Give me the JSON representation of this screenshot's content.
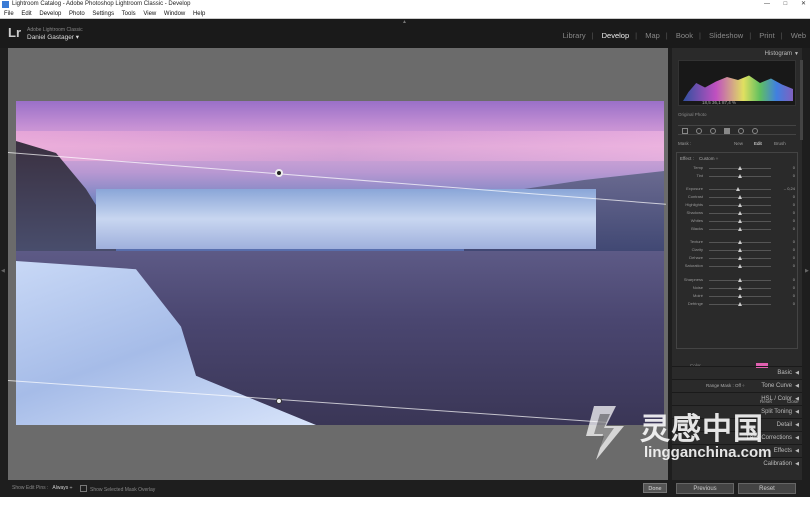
{
  "window": {
    "title": "Lightroom Catalog - Adobe Photoshop Lightroom Classic - Develop",
    "controls": [
      "—",
      "□",
      "✕"
    ]
  },
  "menu": [
    "File",
    "Edit",
    "Develop",
    "Photo",
    "Settings",
    "Tools",
    "View",
    "Window",
    "Help"
  ],
  "identity": {
    "logo": "Lr",
    "brand": "Adobe Lightroom Classic",
    "user": "Daniel Gastager",
    "user_arrow": "▾"
  },
  "modules": [
    "Library",
    "Develop",
    "Map",
    "Book",
    "Slideshow",
    "Print",
    "Web"
  ],
  "active_module": "Develop",
  "panel": {
    "histogram_title": "Histogram",
    "histogram_readout": "18,5  36,1  87,4 %",
    "original_photo": "Original Photo",
    "mask_label": "Mask :",
    "mask_new": "New",
    "mask_edit": "Edit",
    "mask_brush": "Brush",
    "effect_label": "Effect :",
    "effect_value": "Custom ÷",
    "sliders": [
      {
        "label": "Temp",
        "value": "0",
        "pos": 0.5
      },
      {
        "label": "Tint",
        "value": "0",
        "pos": 0.5
      },
      {
        "label": "Exposure",
        "value": "– 0,24",
        "pos": 0.47
      },
      {
        "label": "Contrast",
        "value": "0",
        "pos": 0.5
      },
      {
        "label": "Highlights",
        "value": "0",
        "pos": 0.5
      },
      {
        "label": "Shadows",
        "value": "0",
        "pos": 0.5
      },
      {
        "label": "Whites",
        "value": "0",
        "pos": 0.5
      },
      {
        "label": "Blacks",
        "value": "0",
        "pos": 0.5
      },
      {
        "label": "Texture",
        "value": "0",
        "pos": 0.5
      },
      {
        "label": "Clarity",
        "value": "0",
        "pos": 0.5
      },
      {
        "label": "Dehaze",
        "value": "0",
        "pos": 0.5
      },
      {
        "label": "Saturation",
        "value": "0",
        "pos": 0.5
      },
      {
        "label": "Sharpness",
        "value": "0",
        "pos": 0.5
      },
      {
        "label": "Noise",
        "value": "0",
        "pos": 0.5
      },
      {
        "label": "Moiré",
        "value": "0",
        "pos": 0.5
      },
      {
        "label": "Defringe",
        "value": "0",
        "pos": 0.5
      }
    ],
    "color_label": "Color",
    "color_swatch": "#e060b0",
    "range_mask": "Range Mask : Off ÷",
    "reset": "Reset",
    "close": "Close",
    "sections": [
      "Basic",
      "Tone Curve",
      "HSL / Color",
      "Split Toning",
      "Detail",
      "Lens Corrections",
      "Effects",
      "Calibration"
    ]
  },
  "bottom": {
    "show_edit_pins_label": "Show Edit Pins :",
    "show_edit_pins_value": "Always ÷",
    "show_overlay": "Show Selected Mask Overlay",
    "done": "Done",
    "previous": "Previous",
    "reset": "Reset"
  },
  "watermark": {
    "cn": "灵感中国",
    "en": "lingganchina.com"
  }
}
